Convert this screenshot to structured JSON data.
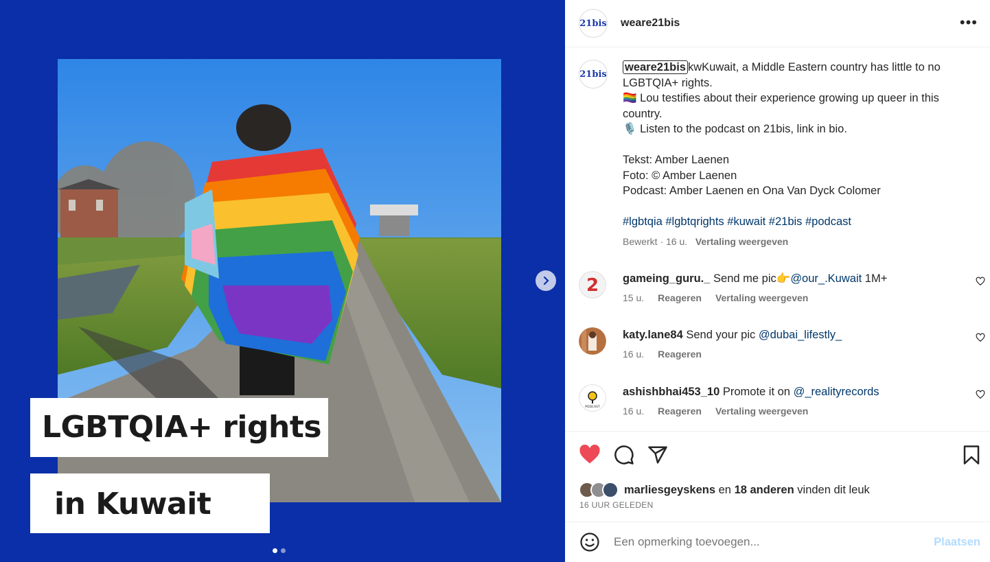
{
  "media": {
    "caption_line1": "LGBTQIA+ rights",
    "caption_line2": "in Kuwait",
    "slides": 2,
    "active_slide": 1,
    "background_color": "#0a2fa8"
  },
  "header": {
    "username": "weare21bis",
    "avatar_text": "21bis",
    "more_icon": "ellipsis-icon"
  },
  "caption": {
    "username": "weare21bis",
    "line1": "kwKuwait, a Middle Eastern country has little to no LGBTQIA+ rights.",
    "line2": "🏳️‍🌈 Lou testifies about their experience growing up queer in this country.",
    "line3": "🎙️ Listen to the podcast on 21bis, link in bio.",
    "credit1": "Tekst: Amber Laenen",
    "credit2": "Foto: © Amber Laenen",
    "credit3": "Podcast: Amber Laenen en Ona Van Dyck Colomer",
    "hashtags": "#lgbtqia #lgbtqrights #kuwait #21bis #podcast",
    "edited": "Bewerkt · 16 u.",
    "translate": "Vertaling weergeven"
  },
  "comments": [
    {
      "user": "gameing_guru._",
      "text": "Send me pic👉",
      "mention": "@our_.Kuwait",
      "suffix": " 1M+",
      "time": "15 u.",
      "reply": "Reageren",
      "translate": "Vertaling weergeven"
    },
    {
      "user": "katy.lane84",
      "text": "Send your pic",
      "mention": "@dubai_lifestly_",
      "time": "16 u.",
      "reply": "Reageren"
    },
    {
      "user": "ashishbhai453_10",
      "text": "Promote it on",
      "mention": "@_realityrecords",
      "avatar_text": "PODCAST",
      "time": "16 u.",
      "reply": "Reageren",
      "translate": "Vertaling weergeven"
    }
  ],
  "likes": {
    "first_user": "marliesgeyskens",
    "connector": "en",
    "others": "18 anderen",
    "suffix": "vinden dit leuk",
    "timestamp": "16 UUR GELEDEN"
  },
  "composer": {
    "placeholder": "Een opmerking toevoegen...",
    "post_label": "Plaatsen"
  },
  "colors": {
    "like_red": "#ed4956",
    "link_blue": "#00376b",
    "post_button_disabled": "#b3dbff"
  }
}
